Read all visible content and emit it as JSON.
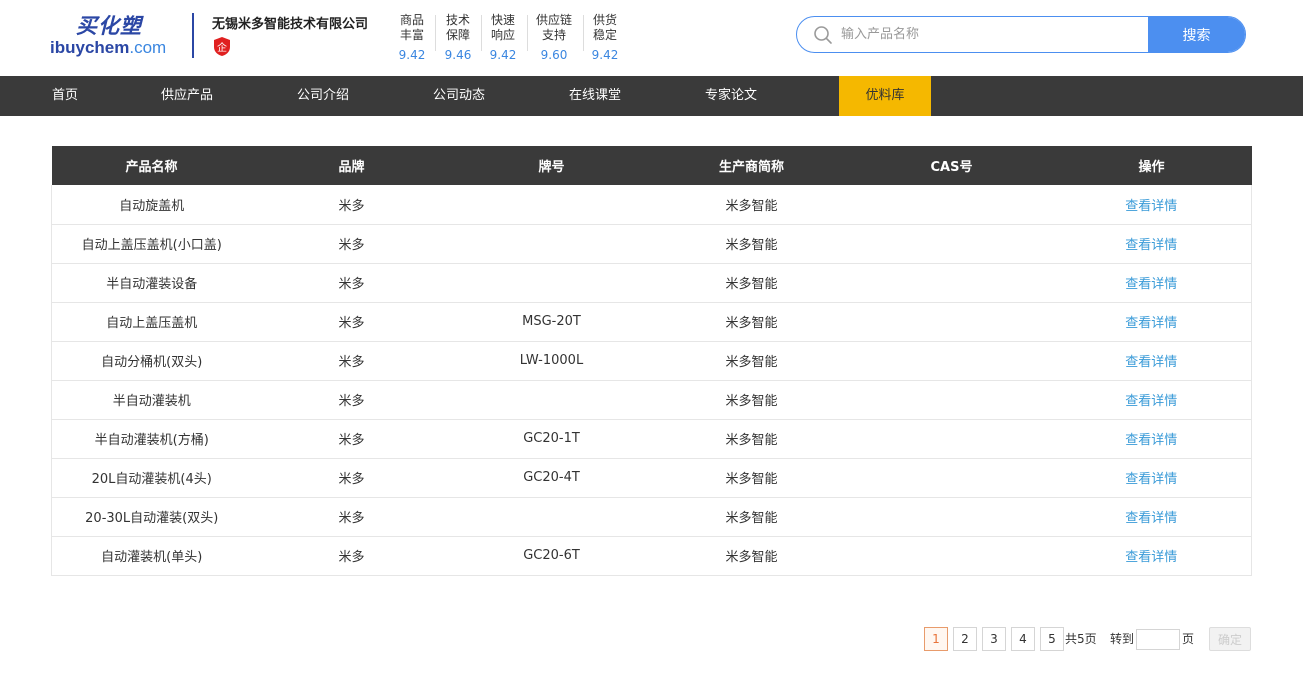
{
  "header": {
    "logo_cn": "买化塑",
    "logo_en_main": "ibuychem",
    "logo_en_suffix": ".com",
    "company_name": "无锡米多智能技术有限公司",
    "badge_icon": "enterprise-badge-icon",
    "badge_text": "企",
    "scores": [
      {
        "line1": "商品",
        "line2": "丰富",
        "value": "9.42"
      },
      {
        "line1": "技术",
        "line2": "保障",
        "value": "9.46"
      },
      {
        "line1": "快速",
        "line2": "响应",
        "value": "9.42"
      },
      {
        "line1": "供应链",
        "line2": "支持",
        "value": "9.60"
      },
      {
        "line1": "供货",
        "line2": "稳定",
        "value": "9.42"
      }
    ],
    "search": {
      "placeholder": "输入产品名称",
      "value": "",
      "button_label": "搜索"
    }
  },
  "nav": {
    "items": [
      {
        "label": "首页"
      },
      {
        "label": "供应产品"
      },
      {
        "label": "公司介绍"
      },
      {
        "label": "公司动态"
      },
      {
        "label": "在线课堂"
      },
      {
        "label": "专家论文"
      },
      {
        "label": "优料库"
      }
    ],
    "active_index": 6,
    "active_color": "#f5b800"
  },
  "table": {
    "headers": [
      "产品名称",
      "品牌",
      "牌号",
      "生产商简称",
      "CAS号",
      "操作"
    ],
    "rows": [
      {
        "name": "自动旋盖机",
        "brand": "米多",
        "grade": "",
        "maker": "米多智能",
        "cas": "",
        "action": "查看详情"
      },
      {
        "name": "自动上盖压盖机(小口盖)",
        "brand": "米多",
        "grade": "",
        "maker": "米多智能",
        "cas": "",
        "action": "查看详情"
      },
      {
        "name": "半自动灌装设备",
        "brand": "米多",
        "grade": "",
        "maker": "米多智能",
        "cas": "",
        "action": "查看详情"
      },
      {
        "name": "自动上盖压盖机",
        "brand": "米多",
        "grade": "MSG-20T",
        "maker": "米多智能",
        "cas": "",
        "action": "查看详情"
      },
      {
        "name": "自动分桶机(双头)",
        "brand": "米多",
        "grade": "LW-1000L",
        "maker": "米多智能",
        "cas": "",
        "action": "查看详情"
      },
      {
        "name": "半自动灌装机",
        "brand": "米多",
        "grade": "",
        "maker": "米多智能",
        "cas": "",
        "action": "查看详情"
      },
      {
        "name": "半自动灌装机(方桶)",
        "brand": "米多",
        "grade": "GC20-1T",
        "maker": "米多智能",
        "cas": "",
        "action": "查看详情"
      },
      {
        "name": "20L自动灌装机(4头)",
        "brand": "米多",
        "grade": "GC20-4T",
        "maker": "米多智能",
        "cas": "",
        "action": "查看详情"
      },
      {
        "name": "20-30L自动灌装(双头)",
        "brand": "米多",
        "grade": "",
        "maker": "米多智能",
        "cas": "",
        "action": "查看详情"
      },
      {
        "name": "自动灌装机(单头)",
        "brand": "米多",
        "grade": "GC20-6T",
        "maker": "米多智能",
        "cas": "",
        "action": "查看详情"
      }
    ]
  },
  "pagination": {
    "pages": [
      "1",
      "2",
      "3",
      "4",
      "5"
    ],
    "current": "1",
    "total_text": "共5页",
    "goto_label": "转到",
    "goto_value": "",
    "unit_label": "页",
    "confirm_label": "确定"
  },
  "colors": {
    "brand_blue": "#2b47a5",
    "accent_blue": "#4c8ff0",
    "link_blue": "#3a9bd8",
    "nav_bg": "#3a3a3a",
    "nav_active": "#f5b800"
  }
}
